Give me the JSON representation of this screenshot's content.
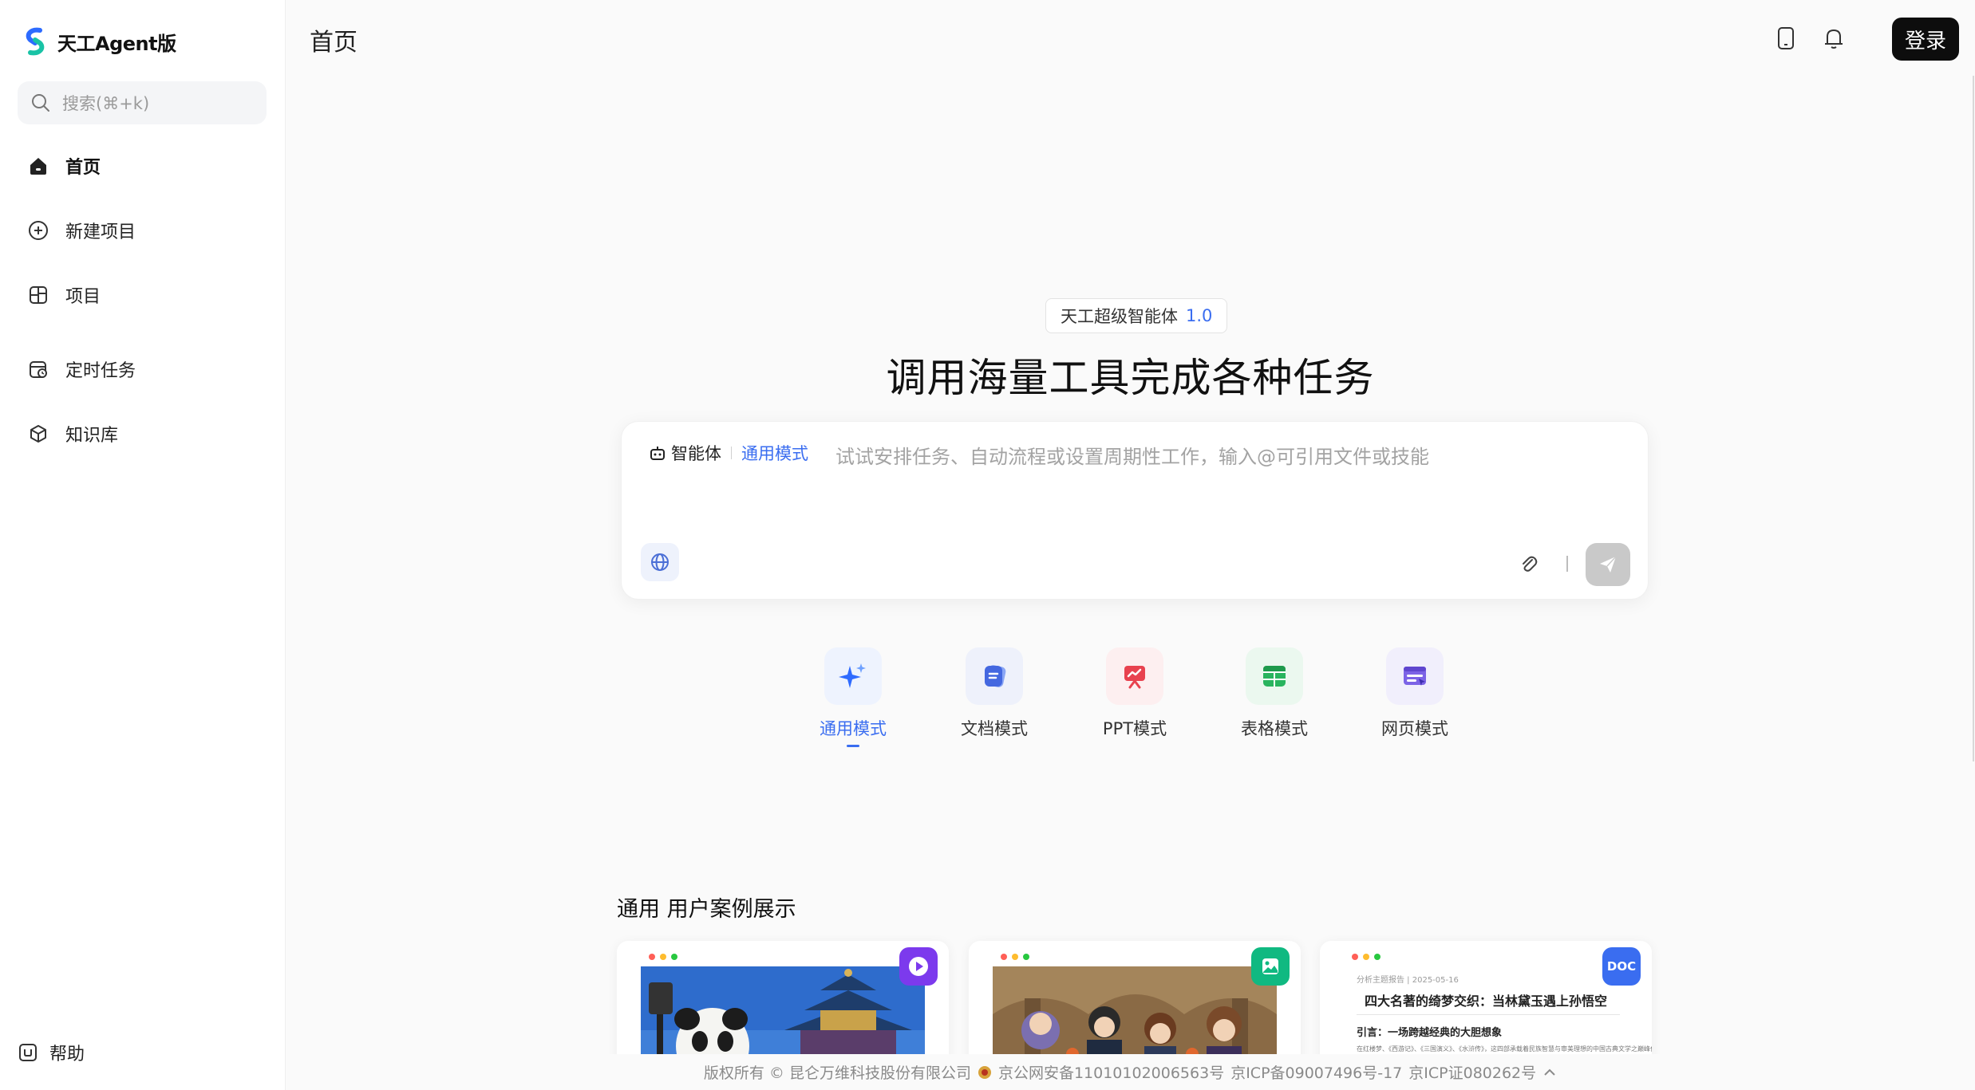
{
  "sidebar": {
    "brand": "天工Agent版",
    "search_placeholder": "搜索(⌘+k)",
    "items": [
      {
        "label": "首页",
        "icon": "home-icon",
        "active": true
      },
      {
        "label": "新建项目",
        "icon": "plus-circle-icon"
      },
      {
        "label": "项目",
        "icon": "project-icon"
      },
      {
        "label": "定时任务",
        "icon": "calendar-clock-icon"
      },
      {
        "label": "知识库",
        "icon": "cube-icon"
      }
    ],
    "help": "帮助"
  },
  "header": {
    "title": "首页",
    "login": "登录",
    "icons": [
      "mobile-icon",
      "bell-icon"
    ]
  },
  "hero": {
    "badge": "天工超级智能体",
    "version": "1.0",
    "title": "调用海量工具完成各种任务"
  },
  "composer": {
    "agent_label": "智能体",
    "mode_label": "通用模式",
    "placeholder": "试试安排任务、自动流程或设置周期性工作，输入@可引用文件或技能"
  },
  "modes": [
    {
      "label": "通用模式",
      "icon": "sparkle-icon",
      "active": true
    },
    {
      "label": "文档模式",
      "icon": "document-icon"
    },
    {
      "label": "PPT模式",
      "icon": "presentation-icon"
    },
    {
      "label": "表格模式",
      "icon": "table-icon"
    },
    {
      "label": "网页模式",
      "icon": "webpage-icon"
    }
  ],
  "cases": {
    "title": "通用 用户案例展示",
    "cards": [
      {
        "type": "video",
        "badge_icon": "play-icon"
      },
      {
        "type": "image",
        "badge_icon": "image-icon"
      },
      {
        "type": "doc",
        "badge_label": "DOC",
        "doc_meta": "分析主题报告 | 2025-05-16",
        "doc_title": "四大名著的绮梦交织：当林黛玉遇上孙悟空",
        "doc_subtitle": "引言：一场跨越经典的大胆想象",
        "doc_body": "在红楼梦、《西游记》、《三国演义》、《水浒传》，这四部承载着民族智慧与审美理想的中国古典文学之巅峰作品，它们"
      }
    ]
  },
  "footer": {
    "copyright": "版权所有 © 昆仑万维科技股份有限公司",
    "police": "京公网安备11010102006563号",
    "icp": "京ICP备09007496号-17",
    "icp_license": "京ICP证080262号",
    "toggle": "^"
  },
  "colors": {
    "accent": "#3a6df0",
    "login_bg": "#0d0d0d"
  }
}
